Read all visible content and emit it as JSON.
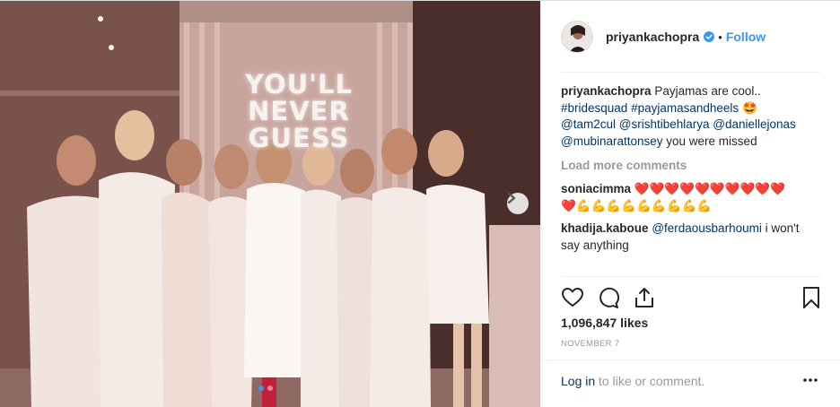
{
  "post": {
    "sign_lines": [
      "YOU'LL",
      "NEVER",
      "GUESS"
    ],
    "header": {
      "username": "priyankachopra",
      "separator": "•",
      "follow_label": "Follow"
    },
    "caption": {
      "username": "priyankachopra",
      "text": "Payjamas are cool..",
      "hashtags": [
        "#bridesquad",
        "#payjamasandheels"
      ],
      "emoji": "🤩",
      "mentions": [
        "@tam2cul",
        "@srishtibehlarya",
        "@daniellejonas",
        "@mubinarattonsey"
      ],
      "after_text": "you were missed"
    },
    "load_more_label": "Load more comments",
    "comments": [
      {
        "username": "soniacimma",
        "hearts_line1": "❤️❤️❤️❤️❤️❤️❤️❤️❤️❤️",
        "line2": "❤️💪💪💪💪💪💪💪💪💪"
      },
      {
        "username": "khadija.kaboue",
        "mention": "@ferdaousbarhoumi",
        "text": "i won't say anything"
      }
    ],
    "likes": "1,096,847 likes",
    "date": "NOVEMBER 7",
    "login": {
      "link": "Log in",
      "text": "to like or comment."
    },
    "carousel": {
      "total": 2,
      "active": 1
    },
    "icons": [
      "heart-icon",
      "comment-icon",
      "share-icon",
      "bookmark-icon",
      "more-options-icon",
      "chevron-right-icon",
      "verified-badge-icon"
    ],
    "colors": {
      "link": "#003569",
      "follow": "#3897f0",
      "muted": "#999999",
      "text": "#262626"
    }
  }
}
